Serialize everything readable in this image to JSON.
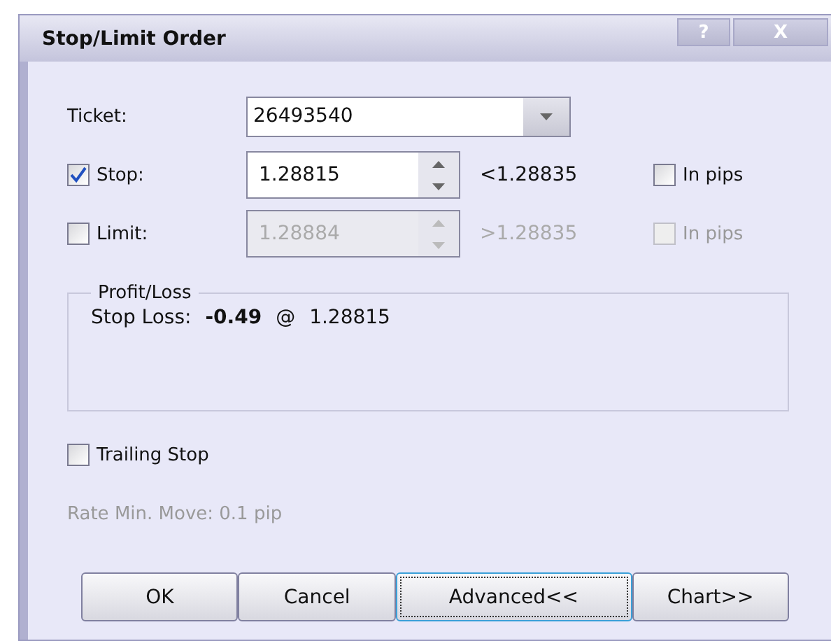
{
  "window": {
    "title": "Stop/Limit Order",
    "help": "?",
    "close": "X"
  },
  "ticket": {
    "label": "Ticket:",
    "value": "26493540"
  },
  "orders": [
    {
      "label": "Stop:",
      "checked": true,
      "value": "1.28815",
      "bound": "<1.28835",
      "pips": {
        "label": "In pips",
        "checked": false
      }
    },
    {
      "label": "Limit:",
      "checked": false,
      "value": "1.28884",
      "bound": ">1.28835",
      "pips": {
        "label": "In pips",
        "checked": false
      }
    }
  ],
  "profit_loss": {
    "title": "Profit/Loss",
    "label": "Stop Loss:",
    "amount": "-0.49",
    "at": "@",
    "rate": "1.28815"
  },
  "trailing_stop": {
    "label": "Trailing Stop",
    "checked": false
  },
  "rate_min_move": "Rate Min. Move: 0.1 pip",
  "buttons": [
    {
      "label": "OK",
      "focused": false
    },
    {
      "label": "Cancel",
      "focused": false
    },
    {
      "label": "Advanced<<",
      "focused": true
    },
    {
      "label": "Chart>>",
      "focused": false
    }
  ]
}
